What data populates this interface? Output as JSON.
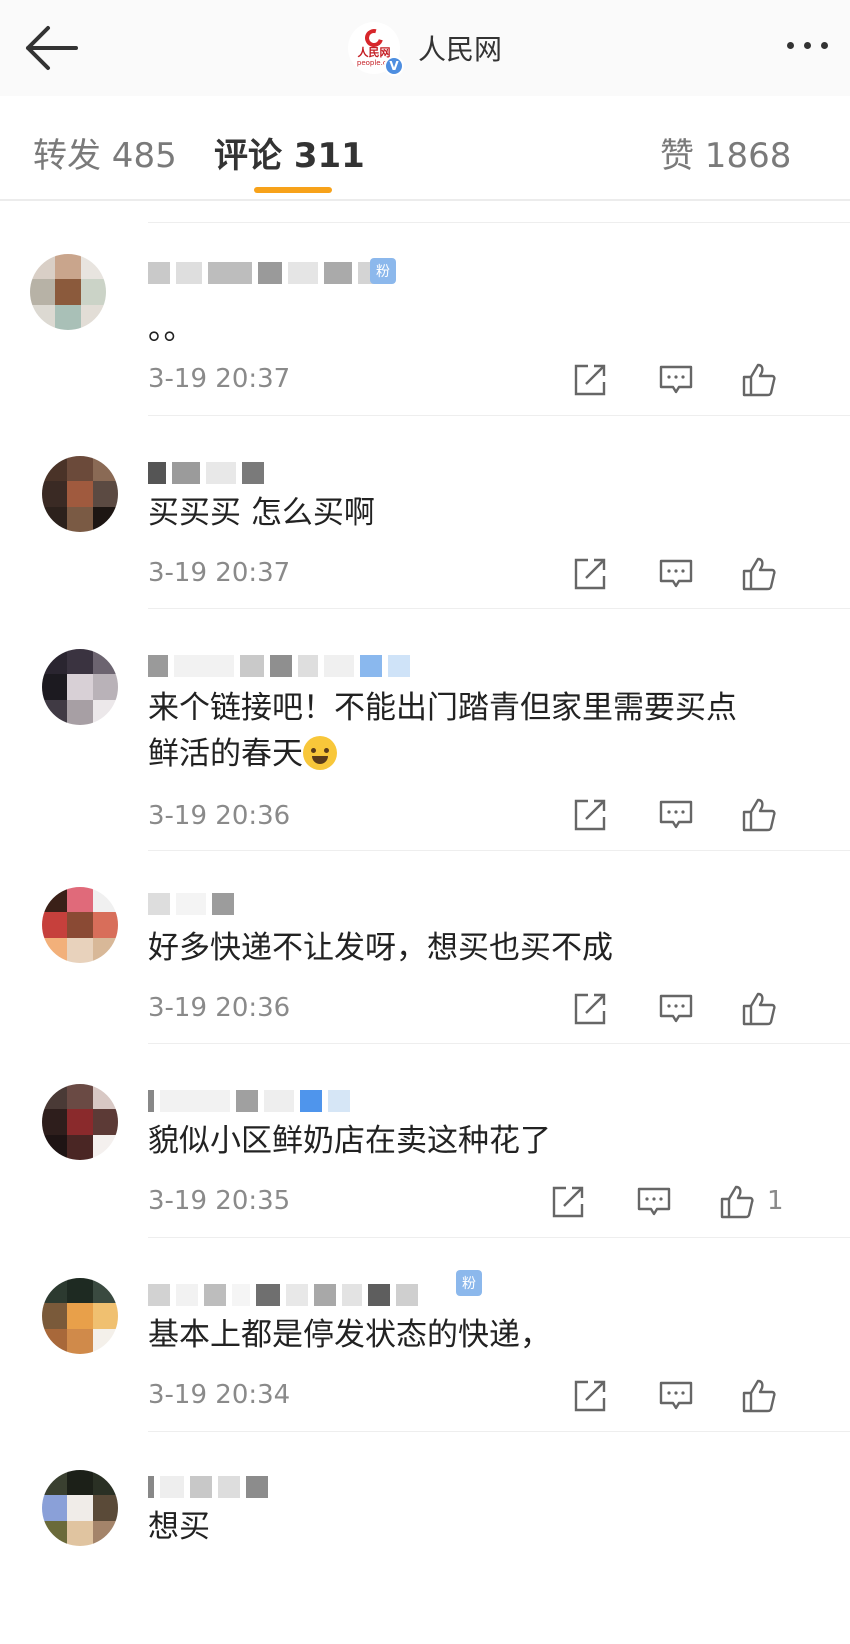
{
  "header": {
    "title": "人民网",
    "logo_text": "人民网",
    "logo_sub": "people.cn",
    "verified_mark": "V"
  },
  "tabs": [
    {
      "label": "转发 485"
    },
    {
      "label": "评论 311"
    },
    {
      "label": "赞 1868"
    }
  ],
  "comments": [
    {
      "text": "。。",
      "time": "3-19 20:37",
      "likes": ""
    },
    {
      "text": "买买买 怎么买啊",
      "time": "3-19 20:37",
      "likes": ""
    },
    {
      "text_line1": "来个链接吧！不能出门踏青但家里需要买点",
      "text_line2": "鲜活的春天",
      "emoji": "crying-emoji",
      "time": "3-19 20:36",
      "likes": ""
    },
    {
      "text": "好多快递不让发呀，想买也买不成",
      "time": "3-19 20:36",
      "likes": ""
    },
    {
      "text": "貌似小区鲜奶店在卖这种花了",
      "time": "3-19 20:35",
      "likes": "1"
    },
    {
      "text": "基本上都是停发状态的快递，",
      "time": "3-19 20:34",
      "likes": ""
    },
    {
      "text": "想买",
      "time": "",
      "likes": ""
    }
  ],
  "fan_badge": "粉",
  "colors": {
    "accent": "#f7a21a",
    "brand_red": "#d7262b",
    "verified_blue": "#4e8ee0"
  },
  "icons": [
    "back-arrow-icon",
    "more-icon",
    "share-icon",
    "comment-icon",
    "like-icon"
  ]
}
